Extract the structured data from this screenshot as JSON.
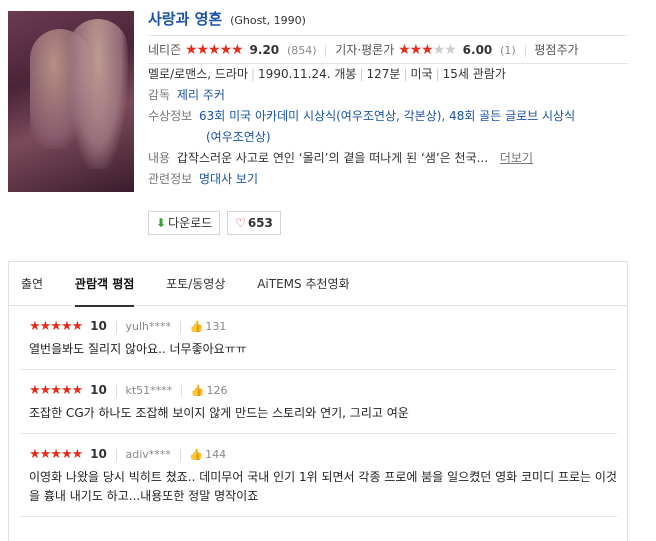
{
  "movie": {
    "title": "사랑과 영혼",
    "original": "(Ghost, 1990)",
    "netizen_label": "네티즌",
    "netizen_score": "9.20",
    "netizen_count": "(854)",
    "critic_label": "기자·평론가",
    "critic_score": "6.00",
    "critic_count": "(1)",
    "rate_link": "평점주가",
    "genre": "멜로/로맨스, 드라마",
    "release": "1990.11.24. 개봉",
    "runtime": "127분",
    "country": "미국",
    "age": "15세 관람가",
    "director_label": "감독",
    "director": "제리 주커",
    "award_label": "수상정보",
    "award_line1": "63회 미국 아카데미 시상식(여우조연상, 각본상), 48회 골든 글로브 시상식",
    "award_line2": "(여우조연상)",
    "summary_label": "내용",
    "summary": "갑작스러운 사고로 연인 ‘몰리’의 곁을 떠나게 된 ‘샘’은 천국...",
    "more": "더보기",
    "related_label": "관련정보",
    "related": "명대사 보기"
  },
  "actions": {
    "download": "다운로드",
    "like_count": "653"
  },
  "tabs": [
    "출연",
    "관람객 평점",
    "포토/동영상",
    "AiTEMS 추천영화"
  ],
  "reviews": [
    {
      "score": "10",
      "user": "yulh****",
      "likes": "131",
      "text": "열번을봐도 질리지 않아요.. 너무좋아요ㅠㅠ"
    },
    {
      "score": "10",
      "user": "kt51****",
      "likes": "126",
      "text": "조잡한 CG가 하나도 조잡해 보이지 않게 만드는 스토리와 연기, 그리고 여운"
    },
    {
      "score": "10",
      "user": "adiv****",
      "likes": "144",
      "text": "이영화 나왔을 당시 빅히트 쳤죠.. 데미무어 국내 인기 1위 되면서 각종 프로에 붐을 일으켰던 영화 코미디 프로는 이것을 흉내 내기도 하고...내용또한 정말 명작이죠"
    }
  ],
  "colors": {
    "star": "#e12f1f",
    "link": "#1a53a6"
  }
}
